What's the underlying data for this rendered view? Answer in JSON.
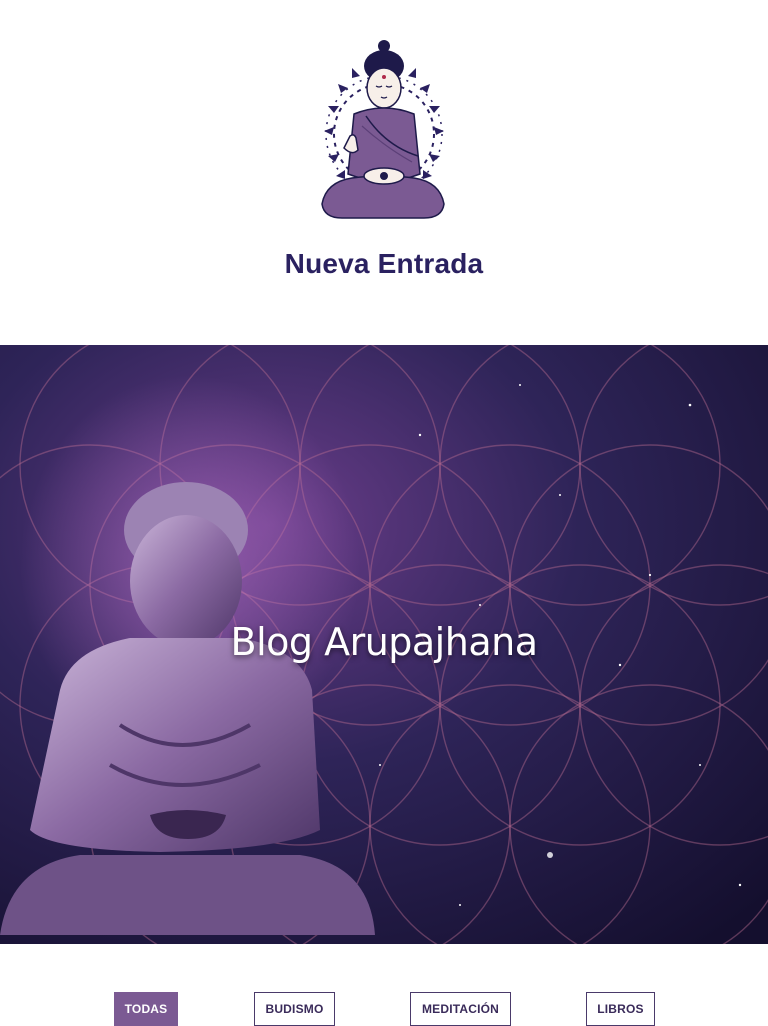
{
  "header": {
    "site_title": "Nueva Entrada",
    "logo_icon": "meditating-buddha-icon"
  },
  "hero": {
    "title": "Blog Arupajhana",
    "image": "buddha-statue-flower-of-life-background"
  },
  "filters": {
    "items": [
      {
        "label": "TODAS",
        "active": true
      },
      {
        "label": "BUDISMO",
        "active": false
      },
      {
        "label": "MEDITACIÓN",
        "active": false
      },
      {
        "label": "LIBROS",
        "active": false
      }
    ]
  },
  "colors": {
    "title": "#2a2160",
    "accent": "#7b5a93",
    "chip_border": "#4a3a6a"
  }
}
